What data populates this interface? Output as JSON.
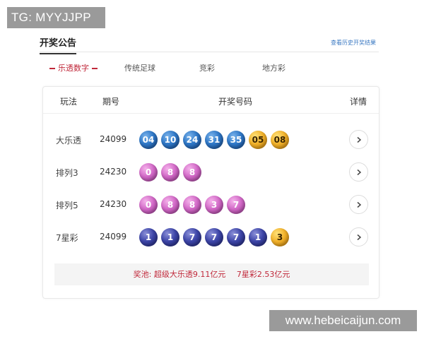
{
  "watermarks": {
    "top": "TG: MYYJJPP",
    "bottom": "www.hebeicaijun.com"
  },
  "header": {
    "title": "开奖公告",
    "history_link": "查看历史开奖结果"
  },
  "tabs": [
    {
      "label": "乐透数字",
      "active": true
    },
    {
      "label": "传统足球",
      "active": false
    },
    {
      "label": "竞彩",
      "active": false
    },
    {
      "label": "地方彩",
      "active": false
    }
  ],
  "table": {
    "headers": {
      "game": "玩法",
      "issue": "期号",
      "numbers": "开奖号码",
      "detail": "详情"
    },
    "rows": [
      {
        "game": "大乐透",
        "issue": "24099",
        "balls": [
          {
            "n": "04",
            "color": "blue"
          },
          {
            "n": "10",
            "color": "blue"
          },
          {
            "n": "24",
            "color": "blue"
          },
          {
            "n": "31",
            "color": "blue"
          },
          {
            "n": "35",
            "color": "blue"
          },
          {
            "n": "05",
            "color": "gold"
          },
          {
            "n": "08",
            "color": "gold"
          }
        ]
      },
      {
        "game": "排列3",
        "issue": "24230",
        "balls": [
          {
            "n": "0",
            "color": "pink"
          },
          {
            "n": "8",
            "color": "pink"
          },
          {
            "n": "8",
            "color": "pink"
          }
        ]
      },
      {
        "game": "排列5",
        "issue": "24230",
        "balls": [
          {
            "n": "0",
            "color": "pink"
          },
          {
            "n": "8",
            "color": "pink"
          },
          {
            "n": "8",
            "color": "pink"
          },
          {
            "n": "3",
            "color": "pink"
          },
          {
            "n": "7",
            "color": "pink"
          }
        ]
      },
      {
        "game": "7星彩",
        "issue": "24099",
        "balls": [
          {
            "n": "1",
            "color": "navy"
          },
          {
            "n": "1",
            "color": "navy"
          },
          {
            "n": "7",
            "color": "navy"
          },
          {
            "n": "7",
            "color": "navy"
          },
          {
            "n": "7",
            "color": "navy"
          },
          {
            "n": "1",
            "color": "navy"
          },
          {
            "n": "3",
            "color": "gold"
          }
        ]
      }
    ]
  },
  "pool": {
    "prefix": "奖池:",
    "dlt": "超级大乐透9.11亿元",
    "qxc": "7星彩2.53亿元"
  },
  "icons": {
    "detail": "chevron-right-icon"
  },
  "colors": {
    "accent_red": "#c0283a",
    "link_blue": "#3a78c2",
    "ball_blue": "#2f78c8",
    "ball_gold": "#f2b22b",
    "ball_pink": "#d36ac8",
    "ball_navy": "#3d45a8"
  }
}
